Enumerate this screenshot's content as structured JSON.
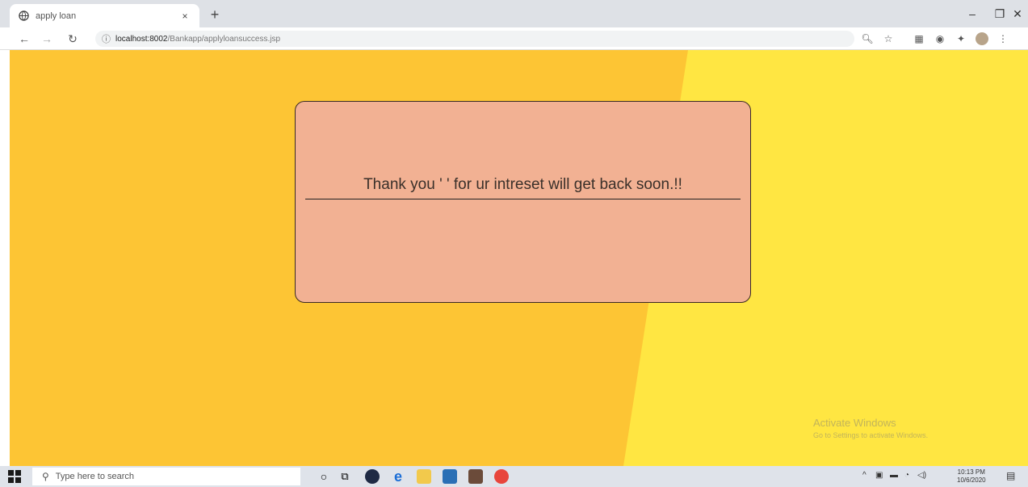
{
  "browser": {
    "tab_title": "apply loan",
    "tab_close": "×",
    "new_tab": "+",
    "url_host": "localhost:8002",
    "url_path": "/Bankapp/applyloansuccess.jsp",
    "window_controls": [
      "–",
      "❐",
      "✕"
    ]
  },
  "page": {
    "message": "Thank you ' ' for ur intreset will get back soon.!!",
    "colors": {
      "left_bg": "#fdc534",
      "right_bg": "#ffe642",
      "card_bg": "#f2b193"
    }
  },
  "watermark": {
    "line1": "Activate Windows",
    "line2": "Go to Settings to activate Windows."
  },
  "taskbar": {
    "search_placeholder": "Type here to search",
    "time": "10:13 PM",
    "date": "10/6/2020"
  }
}
